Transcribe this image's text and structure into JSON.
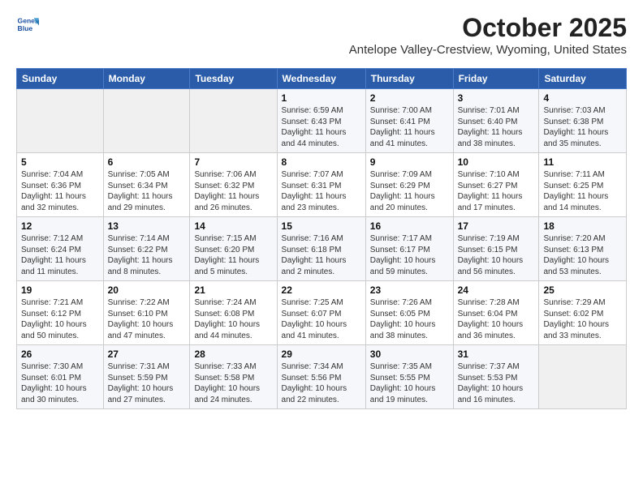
{
  "header": {
    "logo_line1": "General",
    "logo_line2": "Blue",
    "title": "October 2025",
    "subtitle": "Antelope Valley-Crestview, Wyoming, United States"
  },
  "days_of_week": [
    "Sunday",
    "Monday",
    "Tuesday",
    "Wednesday",
    "Thursday",
    "Friday",
    "Saturday"
  ],
  "weeks": [
    [
      {
        "day": "",
        "info": ""
      },
      {
        "day": "",
        "info": ""
      },
      {
        "day": "",
        "info": ""
      },
      {
        "day": "1",
        "info": "Sunrise: 6:59 AM\nSunset: 6:43 PM\nDaylight: 11 hours\nand 44 minutes."
      },
      {
        "day": "2",
        "info": "Sunrise: 7:00 AM\nSunset: 6:41 PM\nDaylight: 11 hours\nand 41 minutes."
      },
      {
        "day": "3",
        "info": "Sunrise: 7:01 AM\nSunset: 6:40 PM\nDaylight: 11 hours\nand 38 minutes."
      },
      {
        "day": "4",
        "info": "Sunrise: 7:03 AM\nSunset: 6:38 PM\nDaylight: 11 hours\nand 35 minutes."
      }
    ],
    [
      {
        "day": "5",
        "info": "Sunrise: 7:04 AM\nSunset: 6:36 PM\nDaylight: 11 hours\nand 32 minutes."
      },
      {
        "day": "6",
        "info": "Sunrise: 7:05 AM\nSunset: 6:34 PM\nDaylight: 11 hours\nand 29 minutes."
      },
      {
        "day": "7",
        "info": "Sunrise: 7:06 AM\nSunset: 6:32 PM\nDaylight: 11 hours\nand 26 minutes."
      },
      {
        "day": "8",
        "info": "Sunrise: 7:07 AM\nSunset: 6:31 PM\nDaylight: 11 hours\nand 23 minutes."
      },
      {
        "day": "9",
        "info": "Sunrise: 7:09 AM\nSunset: 6:29 PM\nDaylight: 11 hours\nand 20 minutes."
      },
      {
        "day": "10",
        "info": "Sunrise: 7:10 AM\nSunset: 6:27 PM\nDaylight: 11 hours\nand 17 minutes."
      },
      {
        "day": "11",
        "info": "Sunrise: 7:11 AM\nSunset: 6:25 PM\nDaylight: 11 hours\nand 14 minutes."
      }
    ],
    [
      {
        "day": "12",
        "info": "Sunrise: 7:12 AM\nSunset: 6:24 PM\nDaylight: 11 hours\nand 11 minutes."
      },
      {
        "day": "13",
        "info": "Sunrise: 7:14 AM\nSunset: 6:22 PM\nDaylight: 11 hours\nand 8 minutes."
      },
      {
        "day": "14",
        "info": "Sunrise: 7:15 AM\nSunset: 6:20 PM\nDaylight: 11 hours\nand 5 minutes."
      },
      {
        "day": "15",
        "info": "Sunrise: 7:16 AM\nSunset: 6:18 PM\nDaylight: 11 hours\nand 2 minutes."
      },
      {
        "day": "16",
        "info": "Sunrise: 7:17 AM\nSunset: 6:17 PM\nDaylight: 10 hours\nand 59 minutes."
      },
      {
        "day": "17",
        "info": "Sunrise: 7:19 AM\nSunset: 6:15 PM\nDaylight: 10 hours\nand 56 minutes."
      },
      {
        "day": "18",
        "info": "Sunrise: 7:20 AM\nSunset: 6:13 PM\nDaylight: 10 hours\nand 53 minutes."
      }
    ],
    [
      {
        "day": "19",
        "info": "Sunrise: 7:21 AM\nSunset: 6:12 PM\nDaylight: 10 hours\nand 50 minutes."
      },
      {
        "day": "20",
        "info": "Sunrise: 7:22 AM\nSunset: 6:10 PM\nDaylight: 10 hours\nand 47 minutes."
      },
      {
        "day": "21",
        "info": "Sunrise: 7:24 AM\nSunset: 6:08 PM\nDaylight: 10 hours\nand 44 minutes."
      },
      {
        "day": "22",
        "info": "Sunrise: 7:25 AM\nSunset: 6:07 PM\nDaylight: 10 hours\nand 41 minutes."
      },
      {
        "day": "23",
        "info": "Sunrise: 7:26 AM\nSunset: 6:05 PM\nDaylight: 10 hours\nand 38 minutes."
      },
      {
        "day": "24",
        "info": "Sunrise: 7:28 AM\nSunset: 6:04 PM\nDaylight: 10 hours\nand 36 minutes."
      },
      {
        "day": "25",
        "info": "Sunrise: 7:29 AM\nSunset: 6:02 PM\nDaylight: 10 hours\nand 33 minutes."
      }
    ],
    [
      {
        "day": "26",
        "info": "Sunrise: 7:30 AM\nSunset: 6:01 PM\nDaylight: 10 hours\nand 30 minutes."
      },
      {
        "day": "27",
        "info": "Sunrise: 7:31 AM\nSunset: 5:59 PM\nDaylight: 10 hours\nand 27 minutes."
      },
      {
        "day": "28",
        "info": "Sunrise: 7:33 AM\nSunset: 5:58 PM\nDaylight: 10 hours\nand 24 minutes."
      },
      {
        "day": "29",
        "info": "Sunrise: 7:34 AM\nSunset: 5:56 PM\nDaylight: 10 hours\nand 22 minutes."
      },
      {
        "day": "30",
        "info": "Sunrise: 7:35 AM\nSunset: 5:55 PM\nDaylight: 10 hours\nand 19 minutes."
      },
      {
        "day": "31",
        "info": "Sunrise: 7:37 AM\nSunset: 5:53 PM\nDaylight: 10 hours\nand 16 minutes."
      },
      {
        "day": "",
        "info": ""
      }
    ]
  ]
}
